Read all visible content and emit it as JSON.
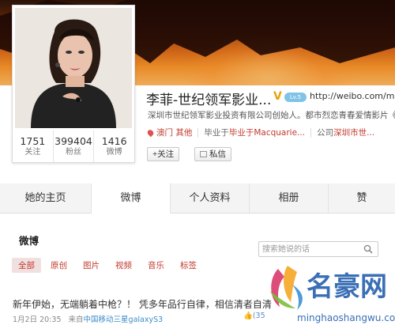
{
  "profile": {
    "name": "李菲-世纪领军影业...",
    "url": "http://weibo.com/macao",
    "level": "Lv.5",
    "intro": "深圳市世纪领军影业投资有限公司创始人。都市烈恋青春爱情影片《谁",
    "tags": {
      "location": "澳门 其他",
      "school": "毕业于Macquarie...",
      "company_prefix": "公司",
      "company": "深圳市世..."
    },
    "follow_label": "+关注",
    "message_label": "私信",
    "stats": [
      {
        "value": "1751",
        "label": "关注"
      },
      {
        "value": "399404",
        "label": "粉丝"
      },
      {
        "value": "1416",
        "label": "微博"
      }
    ]
  },
  "nav": {
    "tabs": [
      "她的主页",
      "微博",
      "个人资料",
      "相册",
      "赞"
    ]
  },
  "feed": {
    "title": "微博",
    "search_placeholder": "搜索她说的话",
    "filters": [
      "全部",
      "原创",
      "图片",
      "视频",
      "音乐",
      "标签"
    ],
    "post": {
      "text": "新年伊始，无端躺着中枪？！ 凭多年品行自律，相信清者自清",
      "time": "1月2日 20:35",
      "source_prefix": "来自",
      "source": "中国移动三星galaxyS3",
      "like_count": "(35"
    }
  },
  "watermark": {
    "brand": "名豪网",
    "url": "minghaoshangwu.com"
  },
  "icons": [
    "v-verified-icon",
    "location-icon",
    "message-icon",
    "search-icon",
    "like-icon"
  ],
  "colors": {
    "accent": "#c0392b",
    "link": "#3c8dc8",
    "verified": "#e8a20c"
  }
}
